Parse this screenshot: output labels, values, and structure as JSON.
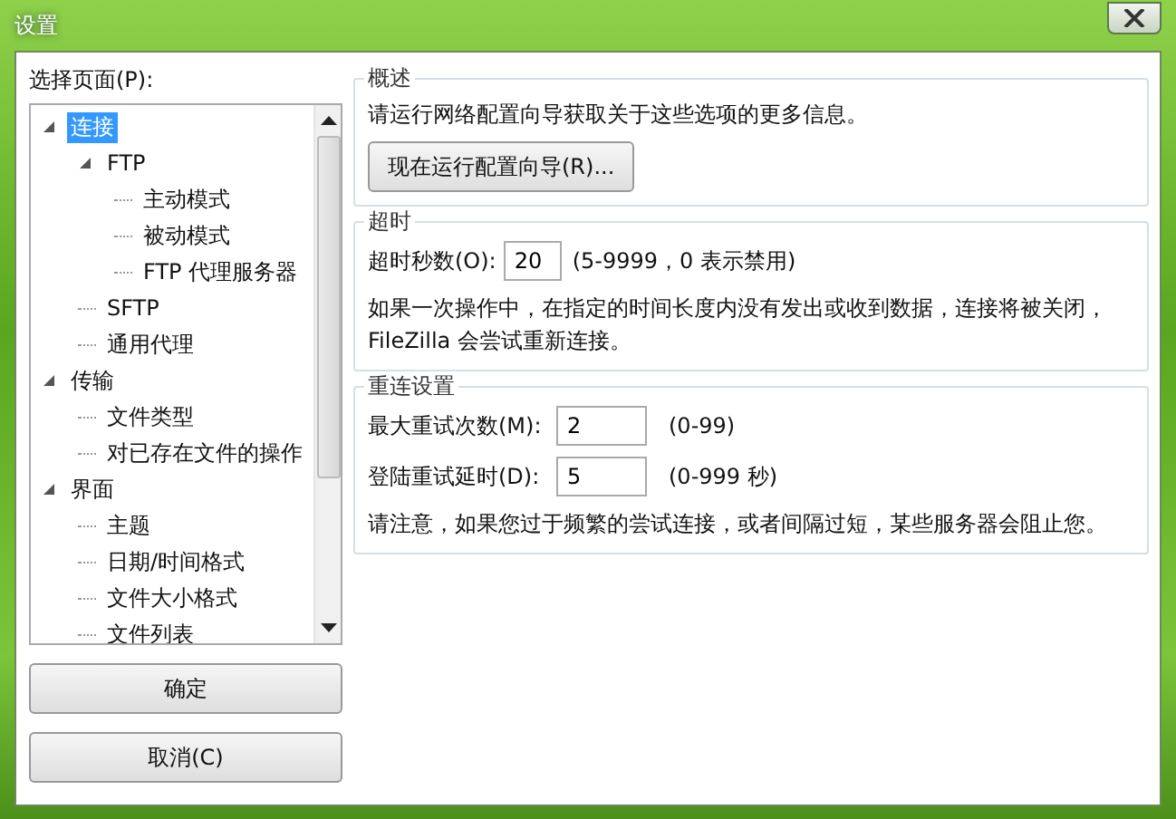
{
  "window": {
    "title": "设置"
  },
  "page_selector": {
    "label": "选择页面(P):",
    "tree": [
      {
        "label": "连接",
        "selected": true,
        "expanded": true,
        "children": [
          {
            "label": "FTP",
            "selected": false,
            "expanded": true,
            "children": [
              {
                "label": "主动模式",
                "selected": false
              },
              {
                "label": "被动模式",
                "selected": false
              },
              {
                "label": "FTP 代理服务器",
                "selected": false
              }
            ]
          },
          {
            "label": "SFTP",
            "selected": false
          },
          {
            "label": "通用代理",
            "selected": false
          }
        ]
      },
      {
        "label": "传输",
        "selected": false,
        "expanded": true,
        "children": [
          {
            "label": "文件类型",
            "selected": false
          },
          {
            "label": "对已存在文件的操作",
            "selected": false
          }
        ]
      },
      {
        "label": "界面",
        "selected": false,
        "expanded": true,
        "children": [
          {
            "label": "主题",
            "selected": false
          },
          {
            "label": "日期/时间格式",
            "selected": false
          },
          {
            "label": "文件大小格式",
            "selected": false
          },
          {
            "label": "文件列表",
            "selected": false
          }
        ]
      }
    ]
  },
  "buttons": [
    "确定",
    "取消(C)"
  ],
  "overview": {
    "title": "概述",
    "text": "请运行网络配置向导获取关于这些选项的更多信息。",
    "button": "现在运行配置向导(R)..."
  },
  "timeout": {
    "title": "超时",
    "field": {
      "label": "超时秒数(O):",
      "value": "20",
      "hint": "(5-9999，0 表示禁用)"
    },
    "text": "如果一次操作中，在指定的时间长度内没有发出或收到数据，连接将被关闭，FileZilla 会尝试重新连接。"
  },
  "reconnect": {
    "title": "重连设置",
    "fields": [
      {
        "label": "最大重试次数(M):",
        "value": "2",
        "hint": "(0-99)"
      },
      {
        "label": "登陆重试延时(D):",
        "value": "5",
        "hint": "(0-999 秒)"
      }
    ],
    "text": "请注意，如果您过于频繁的尝试连接，或者间隔过短，某些服务器会阻止您。"
  }
}
